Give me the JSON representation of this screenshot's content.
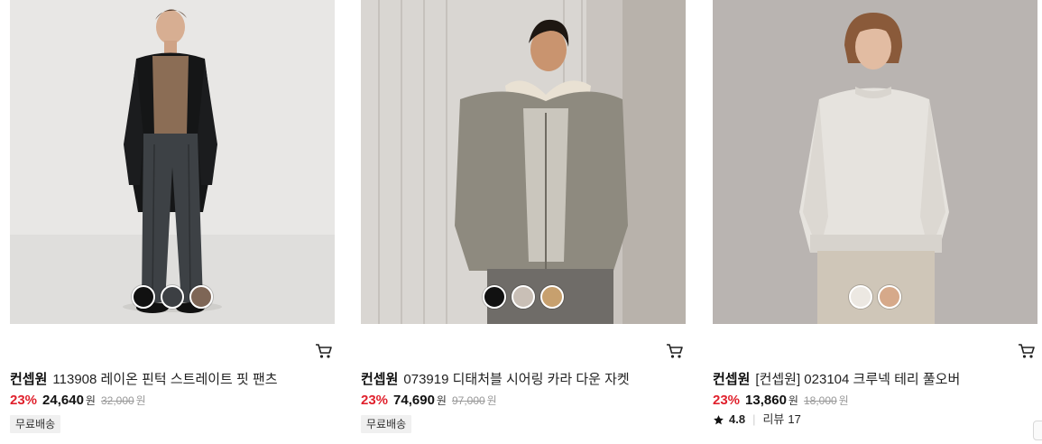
{
  "products": [
    {
      "brand": "컨셉원",
      "name": "113908 레이온 핀턱 스트레이트 핏 팬츠",
      "discount": "23%",
      "price": "24,640",
      "price_unit": "원",
      "original_price": "32,000",
      "original_unit": "원",
      "badge": "무료배송",
      "swatches": [
        "#111111",
        "#3c3f43",
        "#7e6656"
      ]
    },
    {
      "brand": "컨셉원",
      "name": "073919 디태처블 시어링 카라 다운 자켓",
      "discount": "23%",
      "price": "74,690",
      "price_unit": "원",
      "original_price": "97,000",
      "original_unit": "원",
      "badge": "무료배송",
      "swatches": [
        "#111111",
        "#c9bfb6",
        "#c7a06e"
      ]
    },
    {
      "brand": "컨셉원",
      "name": "[컨셉원] 023104 크루넥 테리 풀오버",
      "discount": "23%",
      "price": "13,860",
      "price_unit": "원",
      "original_price": "18,000",
      "original_unit": "원",
      "rating": "4.8",
      "reviews_label": "리뷰",
      "reviews_count": "17",
      "swatches": [
        "#ece8e2",
        "#d6a98a"
      ]
    }
  ],
  "colors": {
    "discount": "#e0212d",
    "badge_bg": "#f0f0f0"
  },
  "icons": [
    "cart-icon",
    "star-icon"
  ]
}
